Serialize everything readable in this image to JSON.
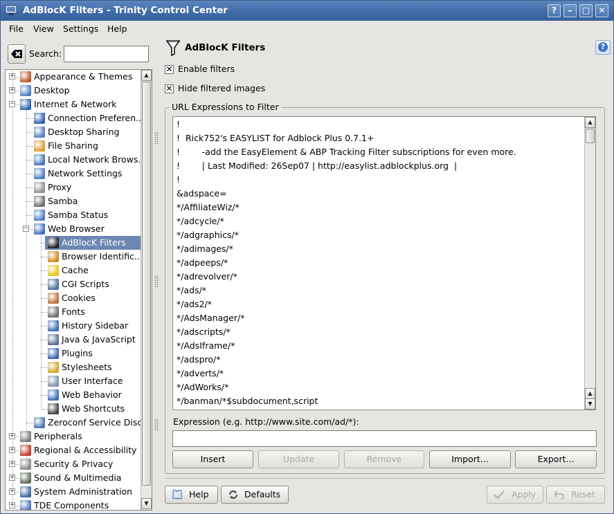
{
  "window": {
    "title": "AdBlocK Filters - Trinity Control Center",
    "help_btn": "?",
    "minimize_btn": "–",
    "maximize_btn": "□",
    "close_btn": "✕"
  },
  "menu": [
    "File",
    "View",
    "Settings",
    "Help"
  ],
  "search": {
    "label": "Search:",
    "value": ""
  },
  "tree": [
    {
      "label": "Appearance & Themes",
      "icon": "appearance-icon",
      "color": "#c0562c"
    },
    {
      "label": "Desktop",
      "icon": "desktop-icon",
      "color": "#4b7fc1"
    },
    {
      "label": "Internet & Network",
      "icon": "internet-icon",
      "color": "#2f62b0"
    },
    {
      "label": "Connection Preferen...",
      "icon": "connection-icon",
      "color": "#2f5fa8"
    },
    {
      "label": "Desktop Sharing",
      "icon": "desktop-sharing-icon",
      "color": "#5a7ec2"
    },
    {
      "label": "File Sharing",
      "icon": "file-sharing-icon",
      "color": "#e09a2b"
    },
    {
      "label": "Local Network Brows...",
      "icon": "local-network-icon",
      "color": "#4575b8"
    },
    {
      "label": "Network Settings",
      "icon": "network-settings-icon",
      "color": "#4d7cc0"
    },
    {
      "label": "Proxy",
      "icon": "proxy-icon",
      "color": "#8f8f8f"
    },
    {
      "label": "Samba",
      "icon": "samba-icon",
      "color": "#6d6d6d"
    },
    {
      "label": "Samba Status",
      "icon": "samba-status-icon",
      "color": "#4f7fc3"
    },
    {
      "label": "Web Browser",
      "icon": "web-browser-icon",
      "color": "#3f72c0"
    },
    {
      "label": "AdBlocK Filters",
      "icon": "funnel-icon",
      "color": "#222222"
    },
    {
      "label": "Browser Identific...",
      "icon": "browser-id-icon",
      "color": "#c98b1e"
    },
    {
      "label": "Cache",
      "icon": "cache-icon",
      "color": "#e8c419"
    },
    {
      "label": "CGI Scripts",
      "icon": "cgi-icon",
      "color": "#4f6f9e"
    },
    {
      "label": "Cookies",
      "icon": "cookies-icon",
      "color": "#b8743a"
    },
    {
      "label": "Fonts",
      "icon": "fonts-icon",
      "color": "#6d6d6d"
    },
    {
      "label": "History Sidebar",
      "icon": "history-icon",
      "color": "#3a6fb5"
    },
    {
      "label": "Java & JavaScript",
      "icon": "java-icon",
      "color": "#5c6e8c"
    },
    {
      "label": "Plugins",
      "icon": "plugins-icon",
      "color": "#3b68ad"
    },
    {
      "label": "Stylesheets",
      "icon": "stylesheets-icon",
      "color": "#d2a52a"
    },
    {
      "label": "User Interface",
      "icon": "user-interface-icon",
      "color": "#8091ad"
    },
    {
      "label": "Web Behavior",
      "icon": "web-behavior-icon",
      "color": "#3b6eb8"
    },
    {
      "label": "Web Shortcuts",
      "icon": "web-shortcuts-icon",
      "color": "#444444"
    },
    {
      "label": "Zeroconf Service Disc...",
      "icon": "zeroconf-icon",
      "color": "#4d74b3"
    },
    {
      "label": "Peripherals",
      "icon": "peripherals-icon",
      "color": "#7a7a7a"
    },
    {
      "label": "Regional & Accessibility",
      "icon": "regional-icon",
      "color": "#c23a2f"
    },
    {
      "label": "Security & Privacy",
      "icon": "security-icon",
      "color": "#8a8a8a"
    },
    {
      "label": "Sound & Multimedia",
      "icon": "sound-icon",
      "color": "#5e6b5c"
    },
    {
      "label": "System Administration",
      "icon": "system-admin-icon",
      "color": "#3b6a9e"
    },
    {
      "label": "TDE Components",
      "icon": "tde-components-icon",
      "color": "#4b78b8"
    }
  ],
  "page": {
    "title": "AdBlocK Filters",
    "enable_filters": "Enable filters",
    "hide_filtered": "Hide filtered images",
    "group_title": "URL Expressions to Filter",
    "expression_label": "Expression (e.g. http://www.site.com/ad/*):",
    "expression_value": "",
    "filters": [
      "!",
      "!  Rick752's EASYLIST for Adblock Plus 0.7.1+",
      "!        -add the EasyElement & ABP Tracking Filter subscriptions for even more.",
      "!        | Last Modified: 26Sep07 | http://easylist.adblockplus.org  |",
      "!",
      "&adspace=",
      "*/AffiliateWiz/*",
      "*/adcycle/*",
      "*/adgraphics/*",
      "*/adimages/*",
      "*/adpeeps/*",
      "*/adrevolver/*",
      "*/ads/*",
      "*/ads2/*",
      "*/AdsManager/*",
      "*/adscripts/*",
      "*/AdsIframe/*",
      "*/adspro/*",
      "*/adverts/*",
      "*/AdWorks/*",
      "*/banman/*$subdocument,script"
    ],
    "buttons": {
      "insert": "Insert",
      "update": "Update",
      "remove": "Remove",
      "import": "Import...",
      "export": "Export..."
    }
  },
  "footer": {
    "help": "Help",
    "defaults": "Defaults",
    "apply": "Apply",
    "reset": "Reset"
  },
  "colors": {
    "titlebar": "#4470ad",
    "selection": "#6b87b2"
  }
}
